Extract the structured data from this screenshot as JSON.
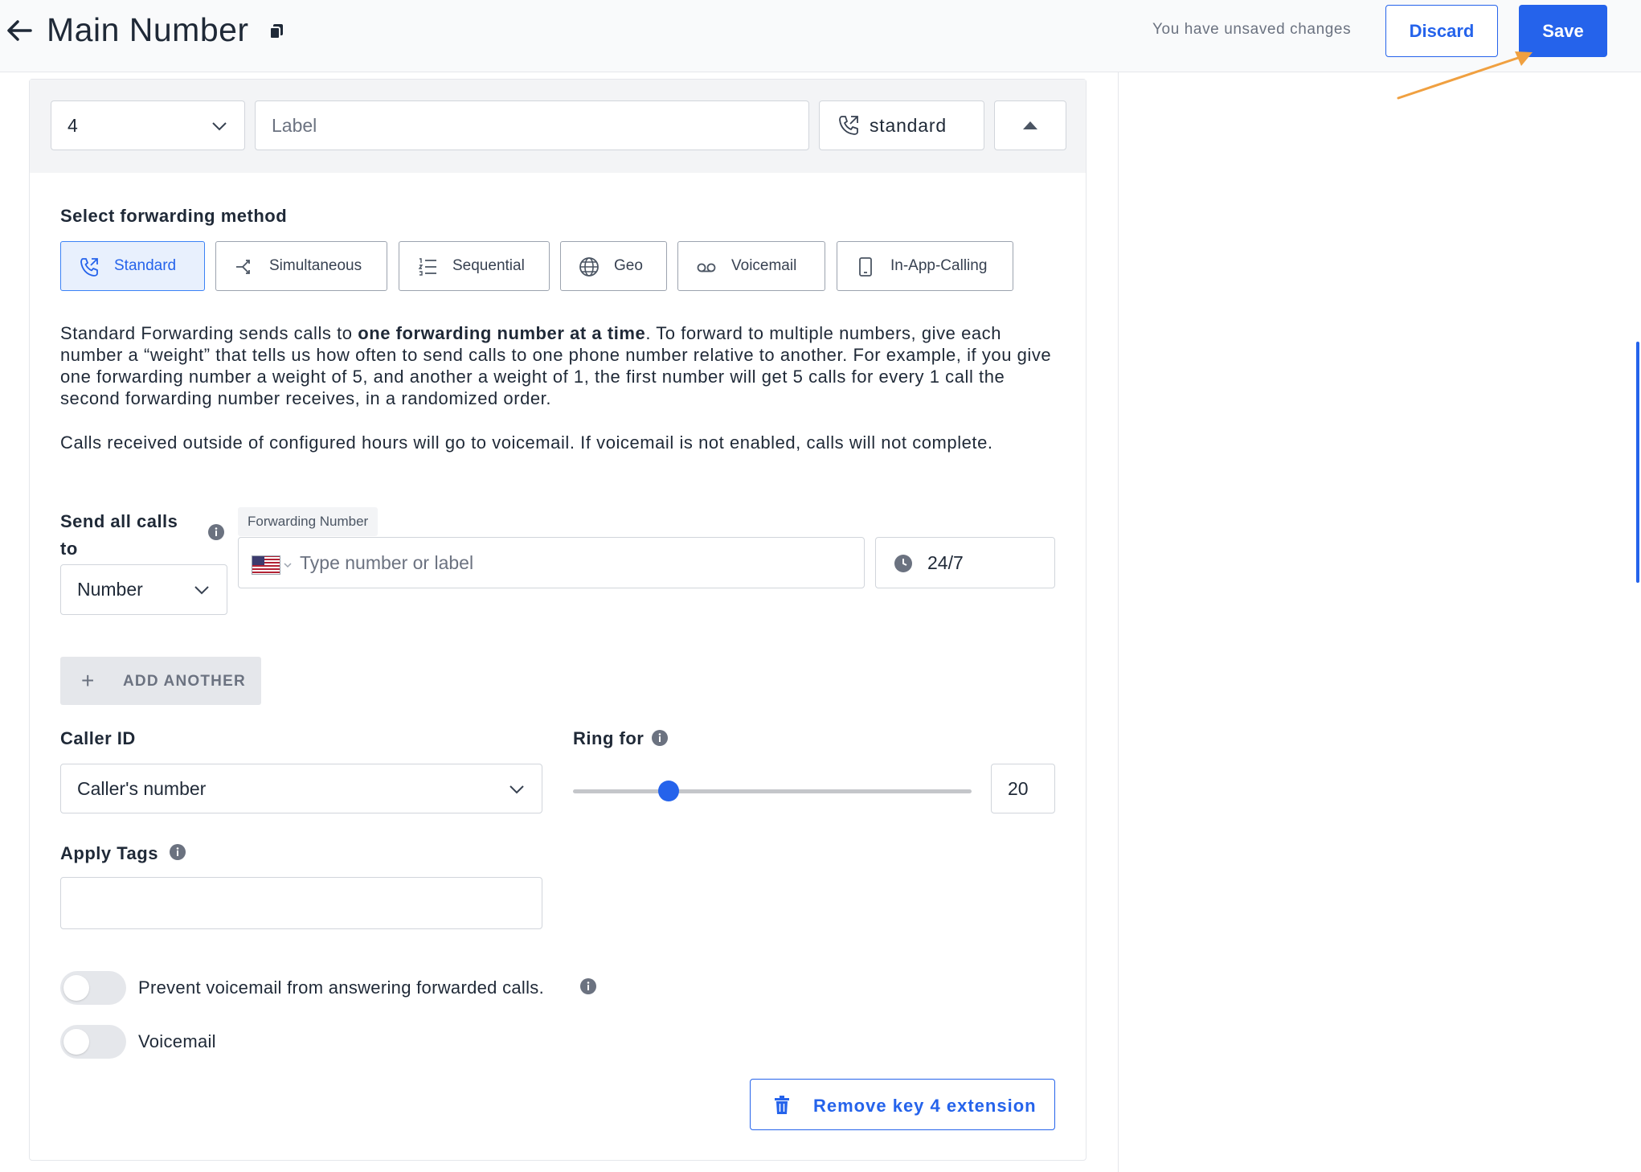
{
  "header": {
    "title": "Main Number",
    "unsaved_text": "You have unsaved changes",
    "discard_label": "Discard",
    "save_label": "Save"
  },
  "extension": {
    "key_value": "4",
    "label_placeholder": "Label",
    "mode_label": "standard"
  },
  "forwarding": {
    "section_label": "Select forwarding method",
    "methods": [
      {
        "label": "Standard",
        "active": true,
        "icon": "phone-forward-icon"
      },
      {
        "label": "Simultaneous",
        "active": false,
        "icon": "split-arrows-icon"
      },
      {
        "label": "Sequential",
        "active": false,
        "icon": "numbered-list-icon"
      },
      {
        "label": "Geo",
        "active": false,
        "icon": "globe-icon"
      },
      {
        "label": "Voicemail",
        "active": false,
        "icon": "voicemail-icon"
      },
      {
        "label": "In-App-Calling",
        "active": false,
        "icon": "mobile-phone-icon"
      }
    ],
    "desc_p1_a": "Standard Forwarding sends calls to ",
    "desc_p1_bold": "one forwarding number at a time",
    "desc_p1_b": ". To forward to multiple numbers, give each number a “weight” that tells us how often to send calls to one phone number relative to another. For example, if you give one forwarding number a weight of 5, and another a weight of 1, the first number will get 5 calls for every 1 call the second forwarding number receives, in a randomized order.",
    "desc_p2": "Calls received outside of configured hours will go to voicemail. If voicemail is not enabled, calls will not complete."
  },
  "send_calls": {
    "label": "Send all calls to",
    "target_type": "Number",
    "field_tag": "Forwarding Number",
    "number_placeholder": "Type number or label",
    "hours": "24/7",
    "add_another_label": "ADD ANOTHER"
  },
  "caller_id": {
    "label": "Caller ID",
    "value": "Caller's number"
  },
  "ring_for": {
    "label": "Ring for",
    "value": "20",
    "fraction": 0.24
  },
  "tags": {
    "label": "Apply Tags"
  },
  "toggles": [
    {
      "label": "Prevent voicemail from answering forwarded calls.",
      "on": false
    },
    {
      "label": "Voicemail",
      "on": false
    }
  ],
  "remove_label": "Remove key 4 extension",
  "colors": {
    "accent": "#2563eb",
    "annotation_arrow": "#f0a040"
  }
}
